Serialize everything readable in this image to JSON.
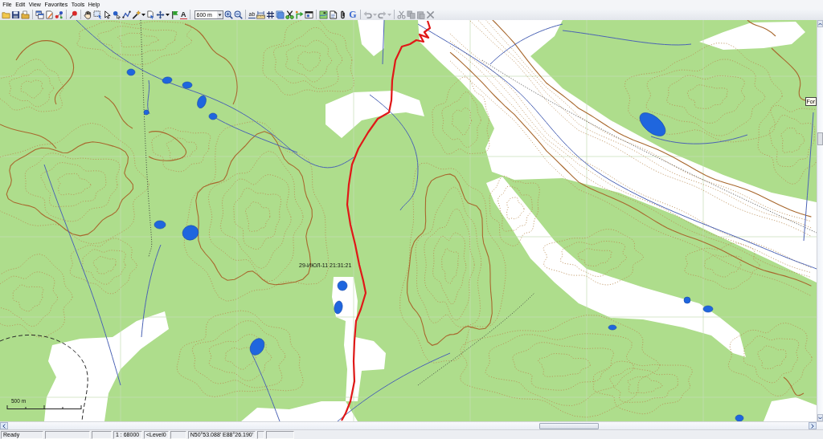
{
  "menu": [
    "File",
    "Edit",
    "View",
    "Favorites",
    "Tools",
    "Help"
  ],
  "toolbar": [
    {
      "kind": "open",
      "disabled": false
    },
    {
      "kind": "save",
      "disabled": false
    },
    {
      "kind": "open-folder",
      "disabled": false
    },
    {
      "kind": "separator"
    },
    {
      "kind": "windows",
      "disabled": false
    },
    {
      "kind": "page-edit",
      "disabled": false
    },
    {
      "kind": "nodes",
      "disabled": false
    },
    {
      "kind": "separator"
    },
    {
      "kind": "pin",
      "disabled": false
    },
    {
      "kind": "separator"
    },
    {
      "kind": "hand",
      "disabled": false
    },
    {
      "kind": "zoom-rect",
      "disabled": false
    },
    {
      "kind": "pointer",
      "disabled": false
    },
    {
      "kind": "point",
      "disabled": false
    },
    {
      "kind": "polyline",
      "disabled": false
    },
    {
      "kind": "wand",
      "disabled": false
    },
    {
      "kind": "caret",
      "disabled": false
    },
    {
      "kind": "select-page",
      "disabled": false
    },
    {
      "kind": "move",
      "disabled": false
    },
    {
      "kind": "caret",
      "disabled": false
    },
    {
      "kind": "flag",
      "disabled": false
    },
    {
      "kind": "font",
      "label": "A",
      "disabled": false
    },
    {
      "kind": "separator"
    },
    {
      "kind": "combo",
      "value": "600 m"
    },
    {
      "kind": "zoom-in",
      "disabled": false
    },
    {
      "kind": "zoom-out",
      "disabled": false
    },
    {
      "kind": "separator"
    },
    {
      "kind": "label",
      "label": "ab",
      "disabled": false
    },
    {
      "kind": "ruler",
      "disabled": false
    },
    {
      "kind": "grid",
      "disabled": false
    },
    {
      "kind": "layers",
      "disabled": false
    },
    {
      "kind": "scissors-tool",
      "disabled": false
    },
    {
      "kind": "bent-arrow",
      "disabled": false
    },
    {
      "kind": "window",
      "disabled": false
    },
    {
      "kind": "separator"
    },
    {
      "kind": "map",
      "disabled": false
    },
    {
      "kind": "page",
      "disabled": false
    },
    {
      "kind": "paperclip",
      "disabled": false
    },
    {
      "kind": "letter",
      "label": "G",
      "disabled": false
    },
    {
      "kind": "separator"
    },
    {
      "kind": "undo",
      "disabled": true
    },
    {
      "kind": "caret",
      "disabled": true
    },
    {
      "kind": "redo",
      "disabled": true
    },
    {
      "kind": "caret",
      "disabled": true
    },
    {
      "kind": "separator"
    },
    {
      "kind": "cut",
      "disabled": true
    },
    {
      "kind": "copy",
      "disabled": true
    },
    {
      "kind": "paste",
      "disabled": true
    },
    {
      "kind": "delete",
      "disabled": true
    }
  ],
  "map": {
    "track_label": "29-ИЮЛ-11 21:31:21",
    "scale_label": "500 m",
    "edge_label": "For"
  },
  "status_bar": {
    "message": "Ready",
    "scale": "1 : 68000",
    "level": "<Level0",
    "coordinates": "N50°53.088' E88°26.190'"
  }
}
